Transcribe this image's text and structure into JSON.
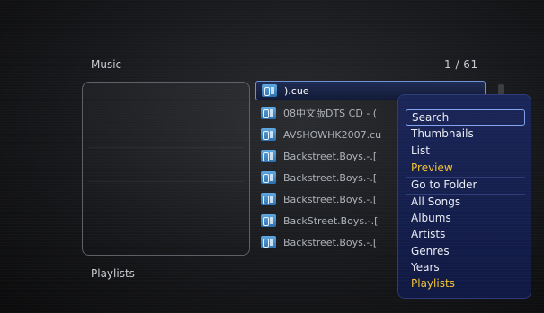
{
  "header": {
    "title": "Music",
    "counter": "1 / 61"
  },
  "footer": {
    "label": "Playlists"
  },
  "files": [
    {
      "name": ").cue",
      "selected": true
    },
    {
      "name": "08中文版DTS CD - ("
    },
    {
      "name": "AVSHOWHK2007.cu"
    },
    {
      "name": "Backstreet.Boys.-.["
    },
    {
      "name": "Backstreet.Boys.-.["
    },
    {
      "name": "Backstreet.Boys.-.["
    },
    {
      "name": "BackStreet.Boys.-.["
    },
    {
      "name": "Backstreet.Boys.-.["
    }
  ],
  "menu": {
    "items": [
      {
        "label": "Search",
        "focused": true
      },
      {
        "label": "Thumbnails"
      },
      {
        "label": "List"
      },
      {
        "label": "Preview",
        "color": "yellow"
      },
      {
        "label": "Go to Folder"
      },
      {
        "label": "All Songs"
      },
      {
        "label": "Albums"
      },
      {
        "label": "Artists"
      },
      {
        "label": "Genres"
      },
      {
        "label": "Years"
      },
      {
        "label": "Playlists",
        "color": "yellow"
      }
    ]
  },
  "colors": {
    "highlight": "#f2c332",
    "menu_bg": "#1b2658",
    "focus_border": "#7fa1ee"
  }
}
